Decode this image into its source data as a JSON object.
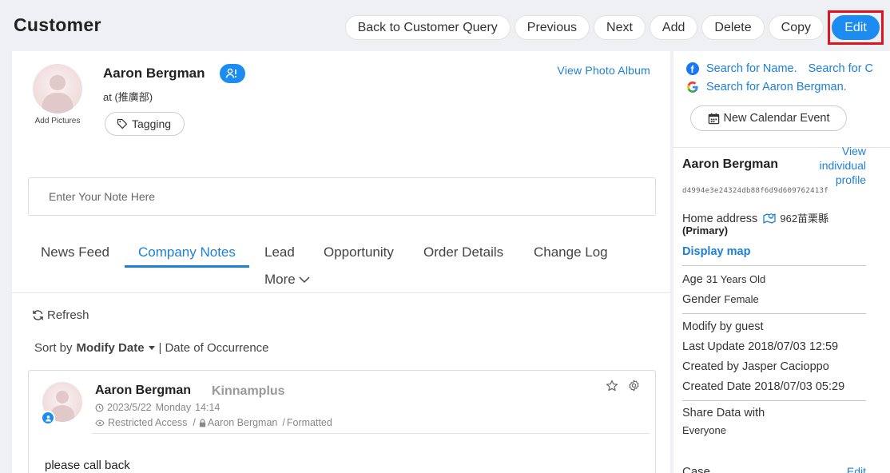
{
  "page": {
    "title": "Customer"
  },
  "toolbar": {
    "back": "Back to Customer Query",
    "previous": "Previous",
    "next": "Next",
    "add": "Add",
    "delete": "Delete",
    "copy": "Copy",
    "edit": "Edit"
  },
  "profile": {
    "add_pictures": "Add Pictures",
    "name": "Aaron Bergman",
    "at": "at (推廣部)",
    "tagging": "Tagging",
    "view_album": "View Photo Album"
  },
  "note": {
    "placeholder": "Enter Your Note Here"
  },
  "tabs": [
    "News Feed",
    "Company Notes",
    "Lead",
    "Opportunity",
    "Order Details",
    "Change Log"
  ],
  "more": "More",
  "feed": {
    "refresh": "Refresh",
    "sort_by": "Sort by",
    "sort_modify": "Modify Date",
    "sort_sep": "|",
    "sort_occurrence": "Date of Occurrence"
  },
  "post": {
    "author": "Aaron Bergman",
    "company": "Kinnamplus",
    "date": "2023/5/22",
    "weekday": "Monday",
    "time": "14:14",
    "access": "Restricted Access",
    "sep1": "/",
    "owner": "Aaron Bergman",
    "sep2": "/",
    "format": "Formatted",
    "body": "please call back"
  },
  "side": {
    "search_name": "Search for Name.",
    "search_for": "Search for C",
    "search_google": "Search for Aaron Bergman.",
    "new_calendar": "New Calendar Event",
    "name": "Aaron Bergman",
    "view_profile": "View individual profile",
    "id": "d4994e3e24324db88f6d9d609762413f",
    "home_label": "Home address",
    "home_value": "962苗栗縣",
    "primary": "(Primary)",
    "display_map": "Display map",
    "age_label": "Age",
    "age_value": "31 Years Old",
    "gender_label": "Gender",
    "gender_value": "Female",
    "modify_by": "Modify by guest",
    "last_update": "Last Update 2018/07/03 12:59",
    "created_by": "Created by Jasper Cacioppo",
    "created_date": "Created Date 2018/07/03 05:29",
    "share_label": "Share Data with",
    "share_value": "Everyone",
    "case_title": "Case",
    "case_edit": "Edit"
  },
  "colors": {
    "accent": "#1c8cf0",
    "link": "#1c7fd8",
    "highlight": "#e0141e",
    "background": "#eef0f4"
  }
}
